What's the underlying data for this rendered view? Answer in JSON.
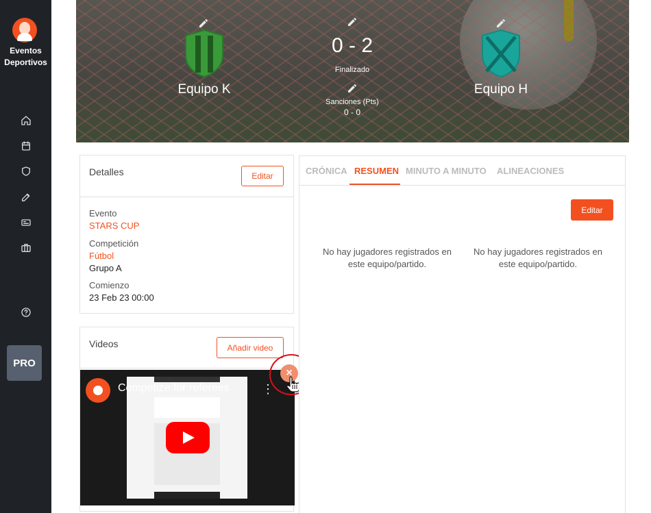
{
  "sidebar": {
    "brand_name": "Eventos Deportivos",
    "nav_icons": [
      "home-icon",
      "calendar-icon",
      "shield-icon",
      "edit-icon",
      "id-card-icon",
      "briefcase-icon",
      "help-icon"
    ],
    "pro_label": "PRO"
  },
  "match": {
    "home_team": "Equipo K",
    "away_team": "Equipo H",
    "score": "0 - 2",
    "status": "Finalizado",
    "sanctions_label": "Sanciones (Pts)",
    "sanctions_value": "0 - 0",
    "home_crest_color": "#3a9a3a",
    "away_crest_color": "#1aa59a"
  },
  "details": {
    "title": "Detalles",
    "edit_label": "Editar",
    "event_label": "Evento",
    "event_value": "STARS CUP",
    "competition_label": "Competición",
    "competition_value": "Fútbol",
    "group_value": "Grupo A",
    "start_label": "Comienzo",
    "start_value": "23 Feb 23 00:00"
  },
  "videos": {
    "title": "Videos",
    "add_label": "Añadir video",
    "video_title": "Competize for referees",
    "remove_icon": "×"
  },
  "tabs": {
    "items": [
      "CRÓNICA",
      "RESUMEN",
      "MINUTO A MINUTO",
      "ALINEACIONES"
    ],
    "active": "RESUMEN"
  },
  "summary": {
    "edit_label": "Editar",
    "home_empty": "No hay jugadores registrados en este equipo/partido.",
    "away_empty": "No hay jugadores registrados en este equipo/partido."
  },
  "colors": {
    "accent": "#f3501f",
    "sidebar": "#1f2328"
  }
}
